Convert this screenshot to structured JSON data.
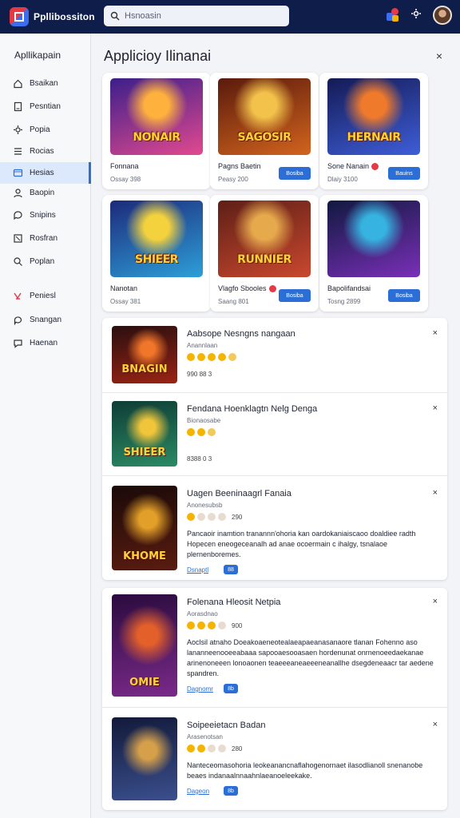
{
  "app": {
    "name": "Ppllibossiton"
  },
  "search": {
    "placeholder": "Hsnoasin"
  },
  "sidebar": {
    "title": "Apllikapain",
    "items": [
      {
        "label": "Bsaikan",
        "icon": "home-icon"
      },
      {
        "label": "Pesntian",
        "icon": "document-icon"
      },
      {
        "label": "Popia",
        "icon": "gear-icon"
      },
      {
        "label": "Rocias",
        "icon": "list-icon"
      },
      {
        "label": "Hesias",
        "icon": "grid-icon",
        "active": true
      },
      {
        "label": "Baopin",
        "icon": "user-icon"
      },
      {
        "label": "Snipins",
        "icon": "chat-icon"
      },
      {
        "label": "Rosfran",
        "icon": "box-icon"
      },
      {
        "label": "Poplan",
        "icon": "search-icon"
      },
      {
        "label": "Peniesl",
        "icon": "x-mark-icon"
      },
      {
        "label": "Snangan",
        "icon": "bubble-icon"
      },
      {
        "label": "Haenan",
        "icon": "message-icon"
      }
    ]
  },
  "main": {
    "title": "Applicioy Ilinanai",
    "close": "×"
  },
  "cards": [
    {
      "art_text": "NONAIR",
      "name": "Fonnana",
      "meta": "Ossay 398",
      "button": "",
      "badge": false,
      "palette": [
        "#3b1f8a",
        "#e2498f",
        "#ffb13d"
      ]
    },
    {
      "art_text": "SAGOSIR",
      "name": "Pagns Baetin",
      "meta": "Peasy 200",
      "button": "Bosiba",
      "badge": false,
      "palette": [
        "#5a1a0c",
        "#d2641e",
        "#f3c24a"
      ]
    },
    {
      "art_text": "HERNAIR",
      "name": "Sone Nanain",
      "meta": "Dlaiy 3100",
      "button": "Bauins",
      "badge": true,
      "palette": [
        "#141a55",
        "#3e5ed8",
        "#f07a2c"
      ]
    },
    {
      "art_text": "SHIEER",
      "name": "Nanotan",
      "meta": "Ossay 381",
      "button": "",
      "badge": false,
      "palette": [
        "#1d2a7a",
        "#2d9fd8",
        "#f4d23e"
      ]
    },
    {
      "art_text": "RUNNIER",
      "name": "Vlagfo Sbooles",
      "meta": "Saang 801",
      "button": "Bosiba",
      "badge": true,
      "palette": [
        "#5e1f16",
        "#c9482f",
        "#e6a94c"
      ]
    },
    {
      "art_text": "",
      "name": "Bapolifandsai",
      "meta": "Tosng 2899",
      "button": "Bosiba",
      "badge": false,
      "palette": [
        "#101940",
        "#7a2fb8",
        "#36b3e0"
      ]
    }
  ],
  "list": [
    {
      "title": "Aabsope Nesngns nangaan",
      "subtitle": "Anannlaan",
      "stars": [
        "on",
        "on",
        "on",
        "on",
        "half"
      ],
      "score": "",
      "meta": "990 88 3",
      "desc": "",
      "link": "",
      "chip": "",
      "art_text": "BNAGIN",
      "palette": [
        "#2a0f0f",
        "#9a2414",
        "#f0762a"
      ]
    },
    {
      "title": "Fendana Hoenklagtn Nelg Denga",
      "subtitle": "Bionaosabe",
      "stars": [
        "on",
        "on",
        "half"
      ],
      "score": "",
      "meta": "8388 0 3",
      "desc": "",
      "link": "",
      "chip": "",
      "art_text": "SHIEER",
      "palette": [
        "#0f3d36",
        "#2b8a64",
        "#f0c53a"
      ]
    },
    {
      "title": "Uagen Beeninaagrl Fanaia",
      "subtitle": "Anonesubsb",
      "stars": [
        "on",
        "off",
        "off",
        "off"
      ],
      "score": "290",
      "meta": "",
      "desc": "Pancaoir inamtion tranannn'ohoria kan oardokaniaiscaoo doaldiee radth Hopecen eneogeceanalh ad anae ocoermain c ihalgy, tsnalaoe plernenboremes.",
      "link": "Dsnaptl",
      "chip": "88",
      "art_text": "KHOME",
      "palette": [
        "#1a0a08",
        "#5a1c10",
        "#e3a028"
      ]
    },
    {
      "title": "Folenana Hleosit Netpia",
      "subtitle": "Aorasdnao",
      "stars": [
        "on",
        "on",
        "on",
        "off"
      ],
      "score": "900",
      "meta": "",
      "desc": "Aoclsil atnaho Doeakoaeneotealaeapaeanasanaore tlanan Fohenno aso lananneenooeeabaaa sapooaesooasaen hordenunat onrnenoeedaekanae arinenoneeen lonoaonen teaeeeaneaeeeneanallhe dsegdeneaacr tar aedene spandren.",
      "link": "Dagnomr",
      "chip": "8b",
      "art_text": "OMIE",
      "palette": [
        "#2a0b3e",
        "#7a2a8a",
        "#e4602a"
      ]
    },
    {
      "title": "Soipeeietacn Badan",
      "subtitle": "Arasenotsan",
      "stars": [
        "on",
        "on",
        "off",
        "off"
      ],
      "score": "280",
      "meta": "",
      "desc": "Nanteceomasohoria leokeanancnaflahogenornaet ilasodlianoll snenanobe beaes indanaalnnaahnlaeanoeleekake.",
      "link": "Dageon",
      "chip": "8b",
      "art_text": "",
      "palette": [
        "#121a3a",
        "#3b4f8e",
        "#d6a04a"
      ]
    }
  ],
  "colors": {
    "topbar": "#0f1d4a",
    "accent": "#2b6fd6",
    "active_bg": "#dce8fb"
  }
}
